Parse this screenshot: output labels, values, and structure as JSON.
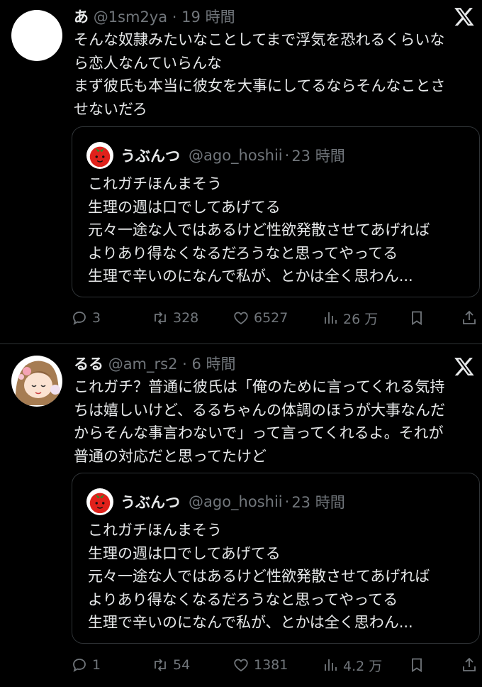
{
  "tweets": [
    {
      "name": "あ",
      "handle": "@1sm2ya",
      "dot": "·",
      "time": "19 時間",
      "lines": [
        "そんな奴隷みたいなことしてまで浮気を恐れるくらいな",
        "ら恋人なんていらんな",
        "まず彼氏も本当に彼女を大事にしてるならそんなことさ",
        "せないだろ"
      ],
      "quote": {
        "name": "うぶんつ",
        "handle": "@ago_hoshii",
        "dot": "·",
        "time": "23 時間",
        "lines": [
          "これガチほんまそう",
          "生理の週は口でしてあげてる",
          "元々一途な人ではあるけど性欲発散させてあげれば",
          "よりあり得なくなるだろうなと思ってやってる",
          "生理で辛いのになんで私が、とかは全く思わん..."
        ]
      },
      "stats": {
        "replies": "3",
        "retweets": "328",
        "likes": "6527",
        "views": "26 万"
      }
    },
    {
      "name": "るる",
      "handle": "@am_rs2",
      "dot": "·",
      "time": "6 時間",
      "lines": [
        "これガチ？普通に彼氏は「俺のために言ってくれる気持",
        "ちは嬉しいけど、るるちゃんの体調のほうが大事なんだ",
        "からそんな事言わないで」って言ってくれるよ。それが",
        "普通の対応だと思ってたけど"
      ],
      "quote": {
        "name": "うぶんつ",
        "handle": "@ago_hoshii",
        "dot": "·",
        "time": "23 時間",
        "lines": [
          "これガチほんまそう",
          "生理の週は口でしてあげてる",
          "元々一途な人ではあるけど性欲発散させてあげれば",
          "よりあり得なくなるだろうなと思ってやってる",
          "生理で辛いのになんで私が、とかは全く思わん..."
        ]
      },
      "stats": {
        "replies": "1",
        "retweets": "54",
        "likes": "1381",
        "views": "4.2 万"
      }
    }
  ],
  "colors": {
    "background": "#000000",
    "text": "#e7e9ea",
    "muted": "#71767b",
    "border": "#2f3336"
  },
  "icons": [
    "x-logo-icon",
    "reply-icon",
    "retweet-icon",
    "like-icon",
    "views-icon",
    "bookmark-icon",
    "share-icon",
    "tomato-avatar-icon"
  ]
}
